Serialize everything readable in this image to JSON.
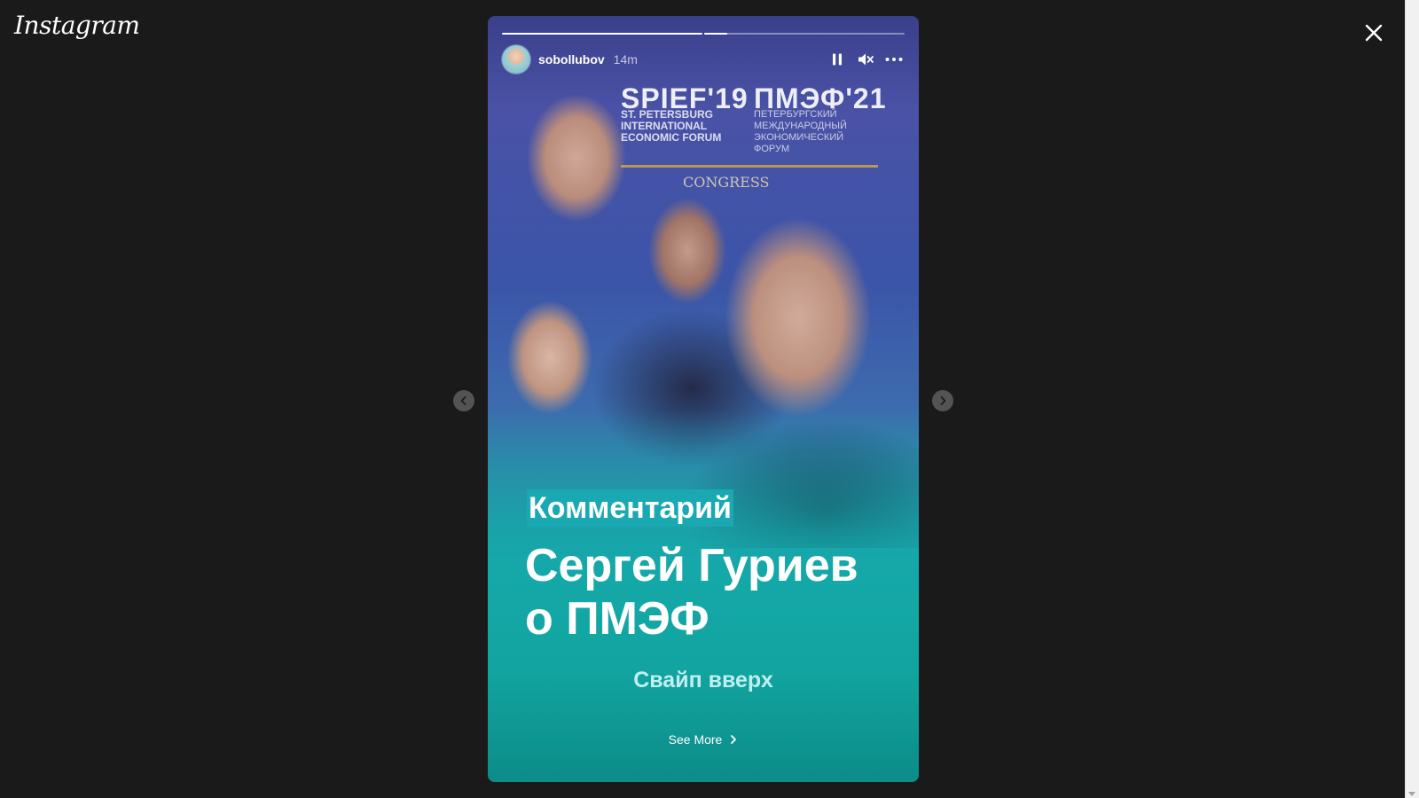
{
  "app": {
    "logo": "Instagram"
  },
  "story": {
    "username": "sobollubov",
    "time": "14m",
    "progress": {
      "segments": 2,
      "current_index": 1,
      "current_fill": 0.11
    },
    "banner": {
      "left_title": "SPIEF'19",
      "left_sub": "ST. PETERSBURG INTERNATIONAL ECONOMIC FORUM",
      "right_title": "ПМЭФ'21",
      "right_sub": "ПЕТЕРБУРГСКИЙ МЕЖДУНАРОДНЫЙ ЭКОНОМИЧЕСКИЙ ФОРУМ",
      "congress": "CONGRESS"
    },
    "tag": "Комментарий",
    "headline_line1": "Сергей Гуриев",
    "headline_line2": "о ПМЭФ",
    "swipe_text": "Свайп вверх",
    "see_more": "See More"
  },
  "colors": {
    "page_bg": "#1a1a1a",
    "tag_bg": "#1aa9b3",
    "banner_line": "#d5a94a"
  }
}
